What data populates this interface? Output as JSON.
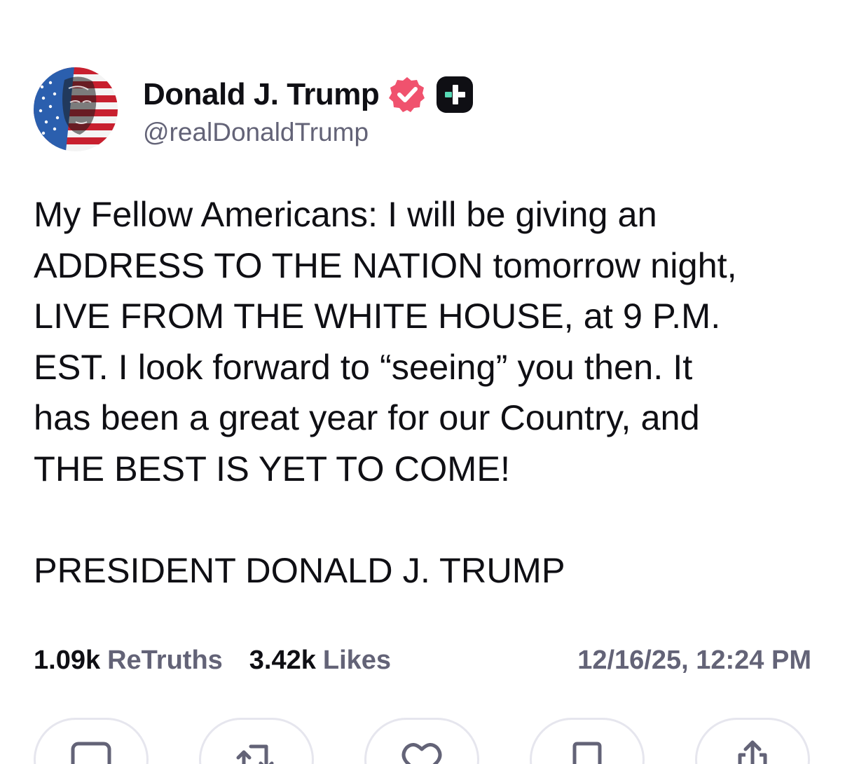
{
  "post": {
    "author": {
      "display_name": "Donald J. Trump",
      "handle": "@realDonaldTrump",
      "avatar_icon": "flag-portrait-avatar",
      "verified_icon": "verified-badge-icon",
      "verified_color": "#f0526e",
      "plus_badge_icon": "truth-plus-icon",
      "plus_badge_color": "#0f0f14",
      "plus_accent_color": "#57d9b5"
    },
    "body_text": "My Fellow Americans: I will be giving an\nADDRESS TO THE NATION tomorrow night,\nLIVE FROM THE WHITE HOUSE, at 9 P.M.\nEST. I look forward to “seeing” you then. It\nhas been a great year for our Country, and\nTHE BEST IS YET TO COME!\n\nPRESIDENT DONALD J. TRUMP",
    "stats": {
      "retruths_count": "1.09k",
      "retruths_label": "ReTruths",
      "likes_count": "3.42k",
      "likes_label": "Likes"
    },
    "timestamp": "12/16/25, 12:24 PM",
    "actions": [
      {
        "name": "reply",
        "icon": "comment-icon"
      },
      {
        "name": "retruth",
        "icon": "retruth-icon"
      },
      {
        "name": "like",
        "icon": "heart-icon"
      },
      {
        "name": "bookmark",
        "icon": "bookmark-icon"
      },
      {
        "name": "share",
        "icon": "share-icon"
      }
    ]
  },
  "colors": {
    "text_primary": "#0f0f14",
    "text_secondary": "#636377",
    "button_border": "#e6e6ee"
  }
}
